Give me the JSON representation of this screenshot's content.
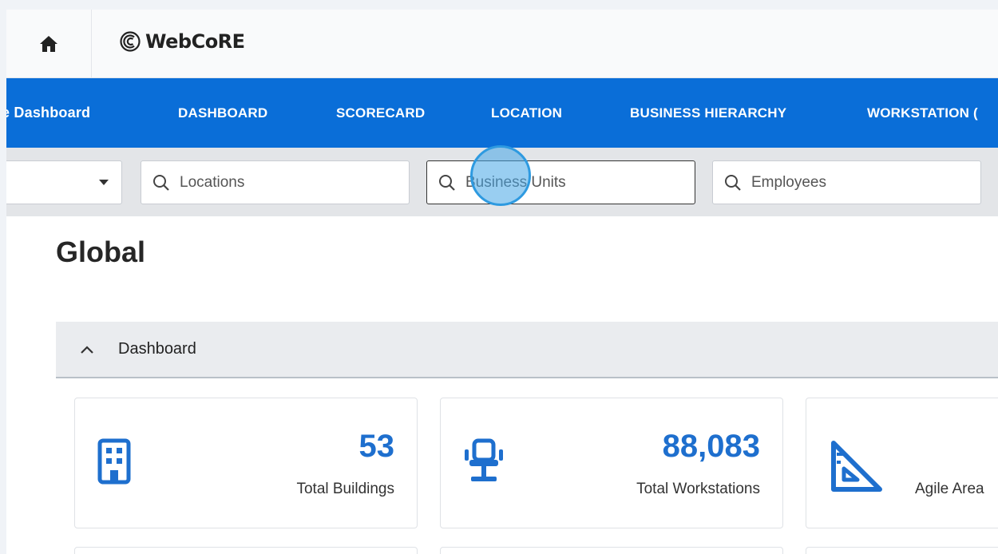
{
  "app": {
    "name": "WebCoRE"
  },
  "nav": {
    "items": [
      "e Dashboard",
      "DASHBOARD",
      "SCORECARD",
      "LOCATION",
      "BUSINESS HIERARCHY",
      "WORKSTATION ("
    ]
  },
  "filters": {
    "locations_placeholder": "Locations",
    "business_units_placeholder": "Business Units",
    "employees_placeholder": "Employees"
  },
  "page": {
    "title": "Global"
  },
  "section": {
    "label": "Dashboard"
  },
  "stats": [
    {
      "value": "53",
      "label": "Total Buildings",
      "icon": "building-icon"
    },
    {
      "value": "88,083",
      "label": "Total Workstations",
      "icon": "office-chair-icon"
    },
    {
      "value": "",
      "label": "Agile Area",
      "icon": "set-square-icon"
    }
  ],
  "colors": {
    "nav_bg": "#0a6ed8",
    "accent": "#1e6fce"
  }
}
